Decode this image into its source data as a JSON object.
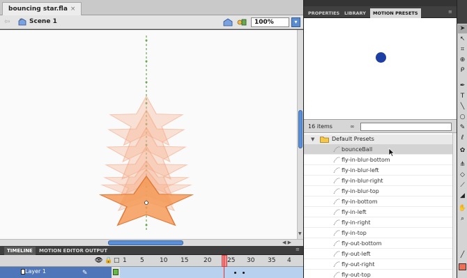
{
  "document": {
    "tab_label": "bouncing star.fla",
    "tab_close": "×",
    "scene_label": "Scene 1",
    "zoom_value": "100%"
  },
  "timeline": {
    "tabs": [
      "TIMELINE",
      "MOTION EDITOR",
      "OUTPUT"
    ],
    "frame_numbers": [
      "1",
      "5",
      "10",
      "15",
      "20",
      "25",
      "30",
      "35",
      "4"
    ],
    "current_frame": 25,
    "layer_name": "Layer 1"
  },
  "panel": {
    "tabs": [
      "PROPERTIES",
      "LIBRARY",
      "MOTION PRESETS"
    ],
    "items_count": "16 items",
    "folder_label": "Default Presets",
    "presets": [
      "bounceBall",
      "fly-in-blur-bottom",
      "fly-in-blur-left",
      "fly-in-blur-right",
      "fly-in-blur-top",
      "fly-in-bottom",
      "fly-in-left",
      "fly-in-right",
      "fly-in-top",
      "fly-out-bottom",
      "fly-out-left",
      "fly-out-right",
      "fly-out-top"
    ],
    "selected_preset": "bounceBall"
  },
  "colors": {
    "star_fill": "#f6b08c",
    "star_front": "#f59a57",
    "motion_path": "#6aa84f",
    "preview_ball": "#1d3fa3",
    "accent_blue": "#5b8fd6"
  }
}
